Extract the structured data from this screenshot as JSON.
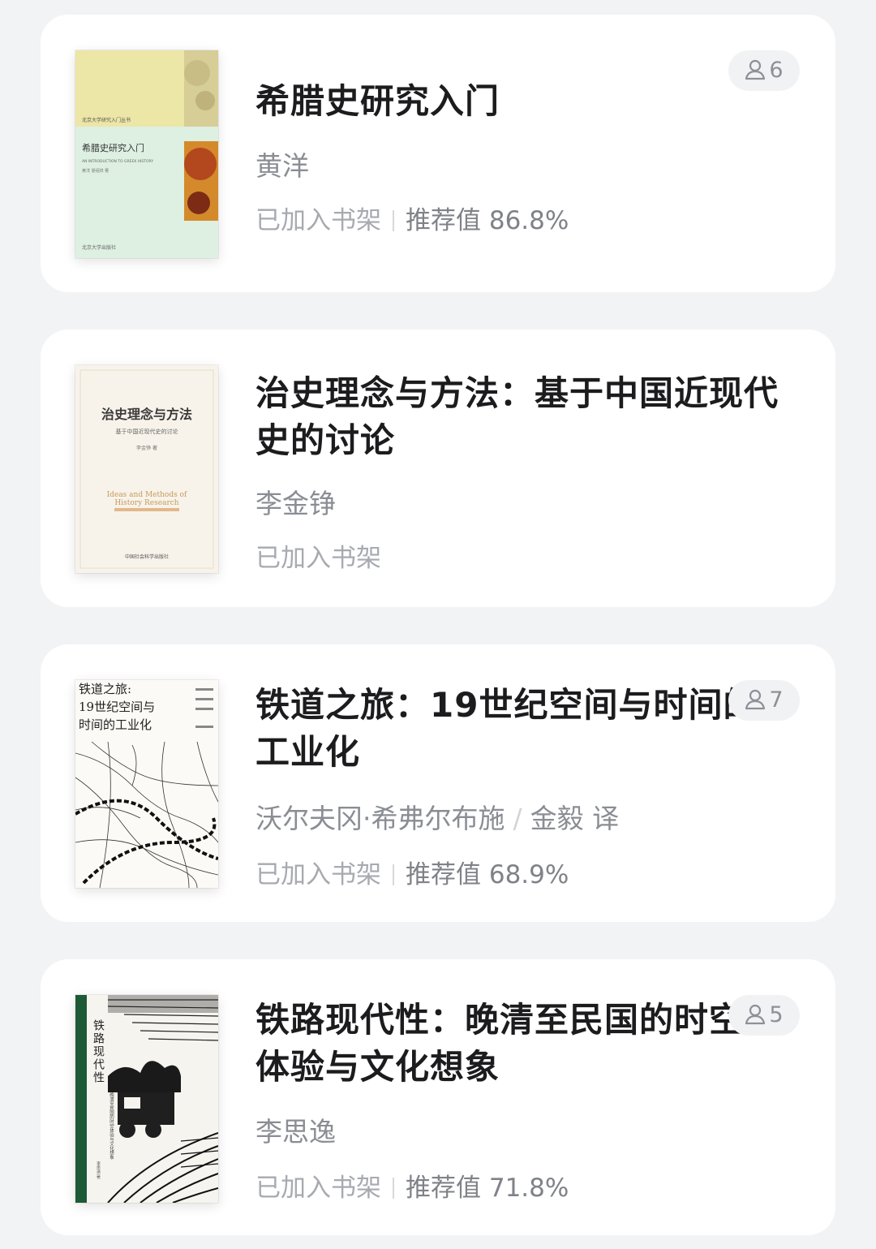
{
  "books": [
    {
      "title": "希腊史研究入门",
      "author": "黄洋",
      "translator": "",
      "shelf_status": "已加入书架",
      "recommend": "推荐值 86.8%",
      "readers": "6",
      "cover": {
        "series": "北京大学研究入门丛书",
        "title": "希腊史研究入门",
        "subtitle": "AN INTRODUCTION TO GREEK HISTORY",
        "author": "黄洋 晏绍祥 著",
        "publisher": "北京大学出版社"
      }
    },
    {
      "title": "治史理念与方法：基于中国近现代史的讨论",
      "author": "李金铮",
      "translator": "",
      "shelf_status": "已加入书架",
      "recommend": "",
      "readers": "",
      "cover": {
        "title": "治史理念与方法",
        "subtitle": "基于中国近现代史的讨论",
        "author": "李金铮 著",
        "en1": "Ideas and Methods of",
        "en2": "History Research",
        "publisher": "中国社会科学出版社"
      }
    },
    {
      "title": "铁道之旅：19世纪空间与时间的工业化",
      "author": "沃尔夫冈·希弗尔布施",
      "translator": "金毅 译",
      "shelf_status": "已加入书架",
      "recommend": "推荐值 68.9%",
      "readers": "7",
      "cover": {
        "line1": "铁道之旅:",
        "line2": "19世纪空间与",
        "line3": "时间的工业化"
      }
    },
    {
      "title": "铁路现代性：晚清至民国的时空体验与文化想象",
      "author": "李思逸",
      "translator": "",
      "shelf_status": "已加入书架",
      "recommend": "推荐值 71.8%",
      "readers": "5",
      "cover": {
        "title": "铁路现代性",
        "subtitle": "晚清至民国的时空体验与文化想象",
        "author": "李思逸 著"
      }
    }
  ],
  "icons": {
    "reader": "person-icon"
  }
}
